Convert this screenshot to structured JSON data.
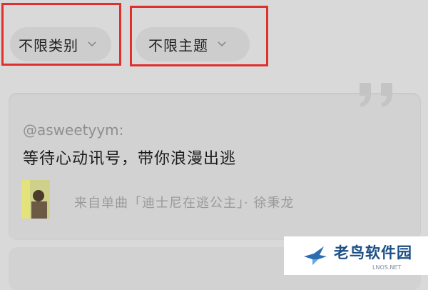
{
  "filters": {
    "category": "不限类别",
    "theme": "不限主题"
  },
  "card": {
    "handle": "@asweetyym:",
    "message": "等待心动讯号，带你浪漫出逃",
    "source": "来自单曲「迪士尼在逃公主」· 徐秉龙"
  },
  "watermark": {
    "name": "老鸟软件园",
    "url": "LNOS.NET"
  },
  "colors": {
    "highlight": "#e0302d",
    "brand": "#1d4f86",
    "background": "#d9d9d9"
  }
}
